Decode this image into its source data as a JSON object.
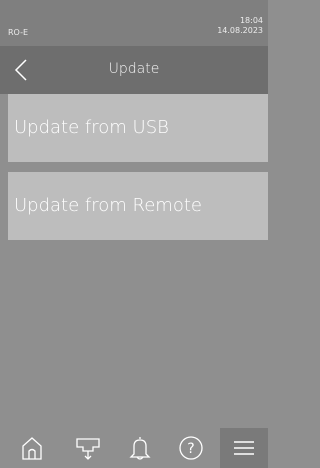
{
  "status_bar": {
    "device_name": "RO-E",
    "time": "18:04",
    "date": "14.08.2023"
  },
  "header": {
    "back_icon": "chevron-left-icon",
    "title": "Update"
  },
  "menu": {
    "items": [
      {
        "label": "Update from USB"
      },
      {
        "label": "Update from Remote"
      }
    ]
  },
  "bottom_nav": {
    "items": [
      {
        "icon": "home-icon"
      },
      {
        "icon": "drain-icon"
      },
      {
        "icon": "bell-icon"
      },
      {
        "icon": "help-icon"
      },
      {
        "icon": "menu-icon",
        "active": true
      }
    ]
  },
  "colors": {
    "background": "#8f8f8f",
    "status_bar": "#7f7f7f",
    "title_bar": "#6e6e6e",
    "menu_item": "#bdbdbd",
    "active_nav": "#7a7a7a",
    "text": "#ffffff"
  }
}
